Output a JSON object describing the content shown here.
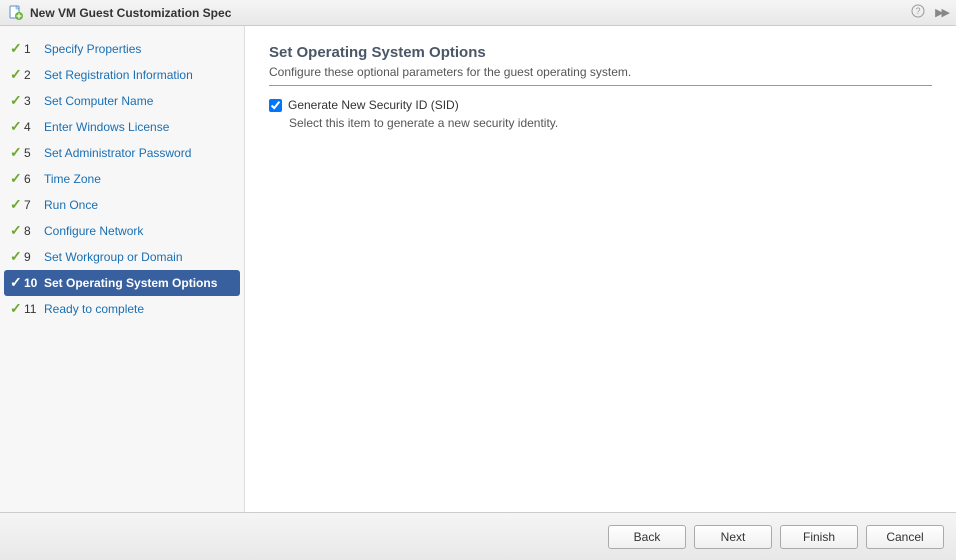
{
  "title": "New VM Guest Customization Spec",
  "steps": [
    {
      "num": "1",
      "label": "Specify Properties",
      "done": true,
      "selected": false
    },
    {
      "num": "2",
      "label": "Set Registration Information",
      "done": true,
      "selected": false
    },
    {
      "num": "3",
      "label": "Set Computer Name",
      "done": true,
      "selected": false
    },
    {
      "num": "4",
      "label": "Enter Windows License",
      "done": true,
      "selected": false
    },
    {
      "num": "5",
      "label": "Set Administrator Password",
      "done": true,
      "selected": false
    },
    {
      "num": "6",
      "label": "Time Zone",
      "done": true,
      "selected": false
    },
    {
      "num": "7",
      "label": "Run Once",
      "done": true,
      "selected": false
    },
    {
      "num": "8",
      "label": "Configure Network",
      "done": true,
      "selected": false
    },
    {
      "num": "9",
      "label": "Set Workgroup or Domain",
      "done": true,
      "selected": false
    },
    {
      "num": "10",
      "label": "Set Operating System Options",
      "done": true,
      "selected": true
    },
    {
      "num": "11",
      "label": "Ready to complete",
      "done": true,
      "selected": false
    }
  ],
  "content": {
    "heading": "Set Operating System Options",
    "subtitle": "Configure these optional parameters for the guest operating system.",
    "option_label": "Generate New Security ID (SID)",
    "option_checked": true,
    "option_desc": "Select this item to generate a new security identity."
  },
  "buttons": {
    "back": "Back",
    "next": "Next",
    "finish": "Finish",
    "cancel": "Cancel"
  }
}
